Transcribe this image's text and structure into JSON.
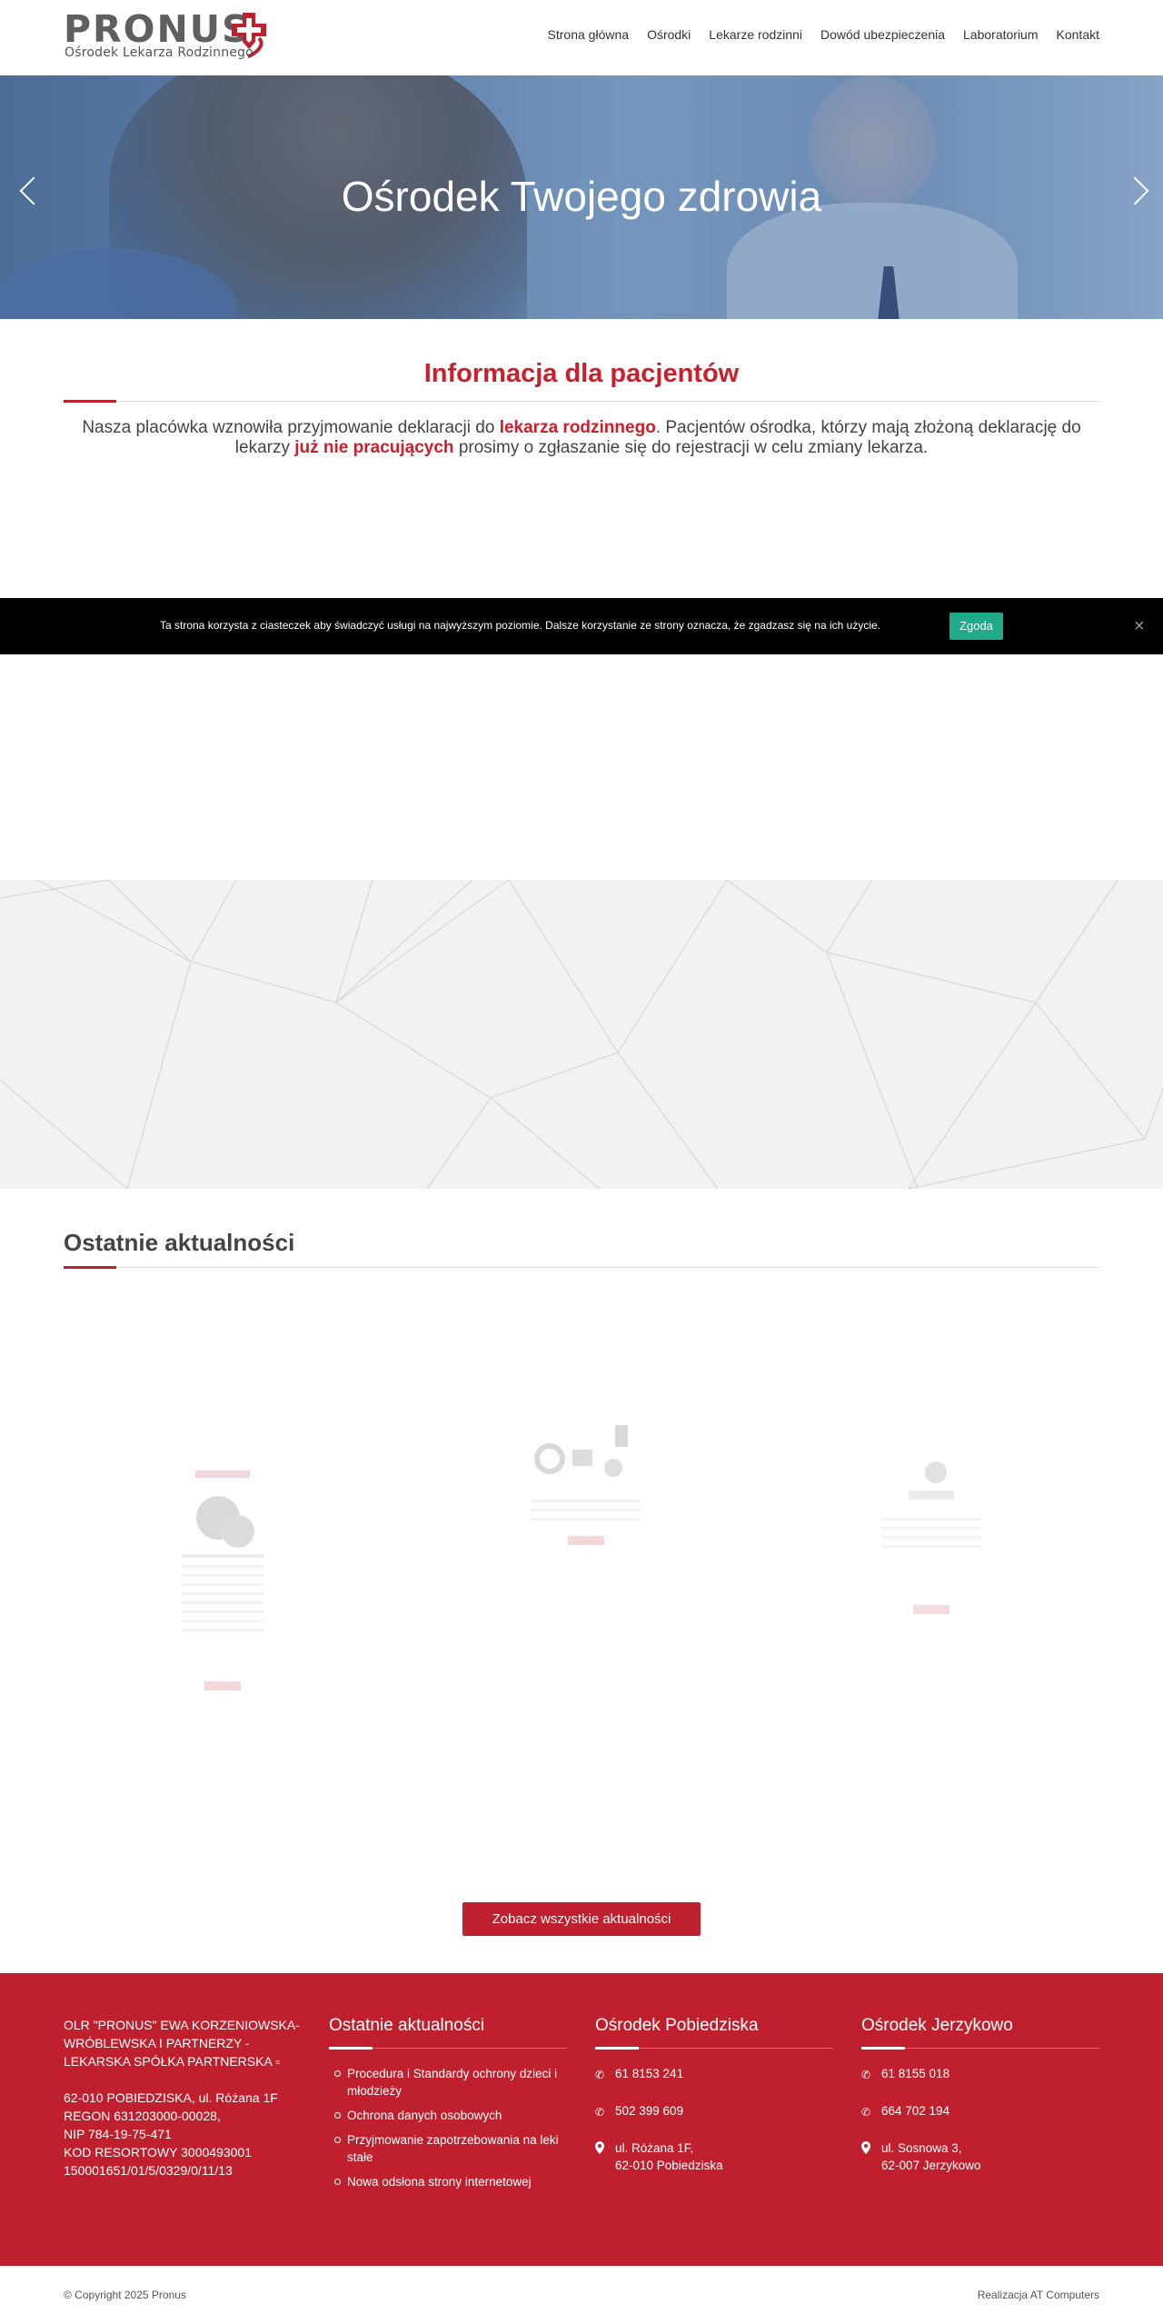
{
  "brand": {
    "name": "PRONUS",
    "tagline": "Ośrodek Lekarza Rodzinnego",
    "accent": "#c0202d"
  },
  "nav": {
    "items": [
      "Strona główna",
      "Ośrodki",
      "Lekarze rodzinni",
      "Dowód ubezpieczenia",
      "Laboratorium",
      "Kontakt"
    ]
  },
  "hero": {
    "title": "Ośrodek Twojego zdrowia"
  },
  "info": {
    "title": "Informacja dla pacjentów",
    "text_1": "Nasza placówka wznowiła przyjmowanie deklaracji do ",
    "highlight_1": "lekarza rodzinnego",
    "text_2": ". Pacjentów ośrodka, którzy mają złożoną deklarację do lekarzy ",
    "highlight_2": "już nie pracujących",
    "text_3": " prosimy o zgłaszanie się do rejestracji w celu zmiany lekarza."
  },
  "cookie": {
    "text": "Ta strona korzysta z ciasteczek aby świadczyć usługi na najwyższym poziomie. Dalsze korzystanie ze strony oznacza, że zgadzasz się na ich użycie.",
    "accept_label": "Zgoda",
    "close_icon": "×",
    "accept_color": "#1fab8a"
  },
  "news": {
    "title": "Ostatnie aktualności",
    "all_button": "Zobacz wszystkie aktualności"
  },
  "footer": {
    "company": {
      "line_1": "OLR \"PRONUS\" EWA KORZENIOWSKA-WRÓBLEWSKA I PARTNERZY - LEKARSKA SPÓŁKA PARTNERSKA ▫",
      "address": "62-010 POBIEDZISKA, ul. Różana 1F",
      "regon": "REGON 631203000-00028,",
      "nip": "NIP 784-19-75-471",
      "kod": "KOD RESORTOWY 3000493001",
      "number": "150001651/01/5/0329/0/11/13"
    },
    "latest": {
      "title": "Ostatnie aktualności",
      "items": [
        "Procedura i Standardy ochrony dzieci i młodzieży",
        "Ochrona danych osobowych",
        "Przyjmowanie zapotrzebowania na leki stałe",
        "Nowa odsłona strony internetowej"
      ]
    },
    "pobiedziska": {
      "title": "Ośrodek Pobiedziska",
      "phone_1": "61 8153 241",
      "phone_2": "502 399 609",
      "street": "ul. Różana 1F,",
      "city": "62-010 Pobiedziska"
    },
    "jerzykowo": {
      "title": "Ośrodek Jerzykowo",
      "phone_1": "61 8155 018",
      "phone_2": "664 702 194",
      "street": "ul. Sosnowa 3,",
      "city": "62-007 Jerzykowo"
    }
  },
  "bottom": {
    "copyright": "© Copyright 2025 Pronus",
    "credit": "Realizacja AT Computers"
  }
}
